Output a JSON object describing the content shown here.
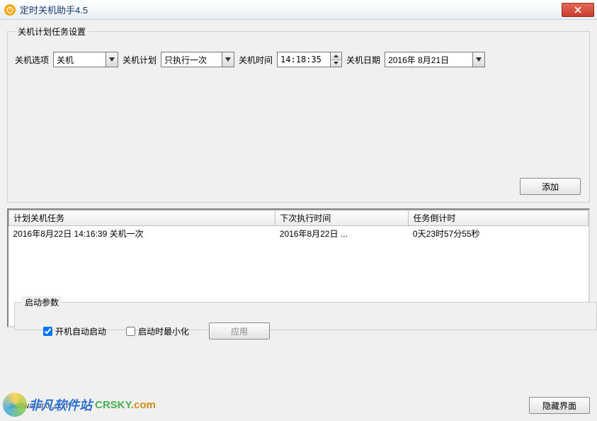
{
  "window": {
    "title": "定时关机助手4.5",
    "close_tooltip": "关闭"
  },
  "schedule_group": {
    "legend": "关机计划任务设置",
    "option_label": "关机选项",
    "option_value": "关机",
    "plan_label": "关机计划",
    "plan_value": "只执行一次",
    "time_label": "关机时间",
    "time_value": "14:18:35",
    "date_label": "关机日期",
    "date_value": "2016年 8月21日",
    "add_button": "添加"
  },
  "tasklist": {
    "columns": [
      "计划关机任务",
      "下次执行时间",
      "任务倒计时"
    ],
    "rows": [
      {
        "task": "2016年8月22日 14:16:39 关机一次",
        "next": "2016年8月22日 ...",
        "countdown": "0天23时57分55秒"
      }
    ]
  },
  "startup_group": {
    "legend": "启动参数",
    "autostart_label": "开机自动启动",
    "autostart_checked": true,
    "minimize_label": "启动时最小化",
    "minimize_checked": false,
    "apply_button": "应用"
  },
  "footer": {
    "website": ".softwarejxk.com",
    "hide_button": "隐藏界面"
  },
  "watermark": {
    "zh": "非凡软件站",
    "en": "CRSKY",
    "dotcom": ".com"
  }
}
